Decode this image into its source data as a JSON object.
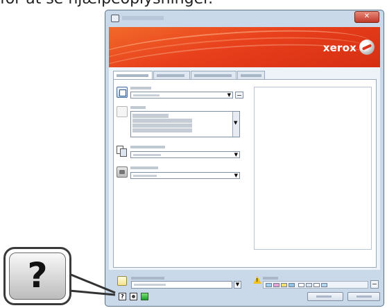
{
  "caption": "for at se hjælpeoplysninger.",
  "brand": {
    "name": "xerox",
    "accent": "#e8401c"
  },
  "window": {
    "close_icon": "close-icon"
  },
  "dialog": {
    "tabs": [
      {},
      {},
      {},
      {}
    ],
    "sections": [
      {},
      {},
      {},
      {}
    ]
  },
  "callout": {
    "symbol": "?"
  },
  "footer": {
    "help_symbol": "?"
  }
}
